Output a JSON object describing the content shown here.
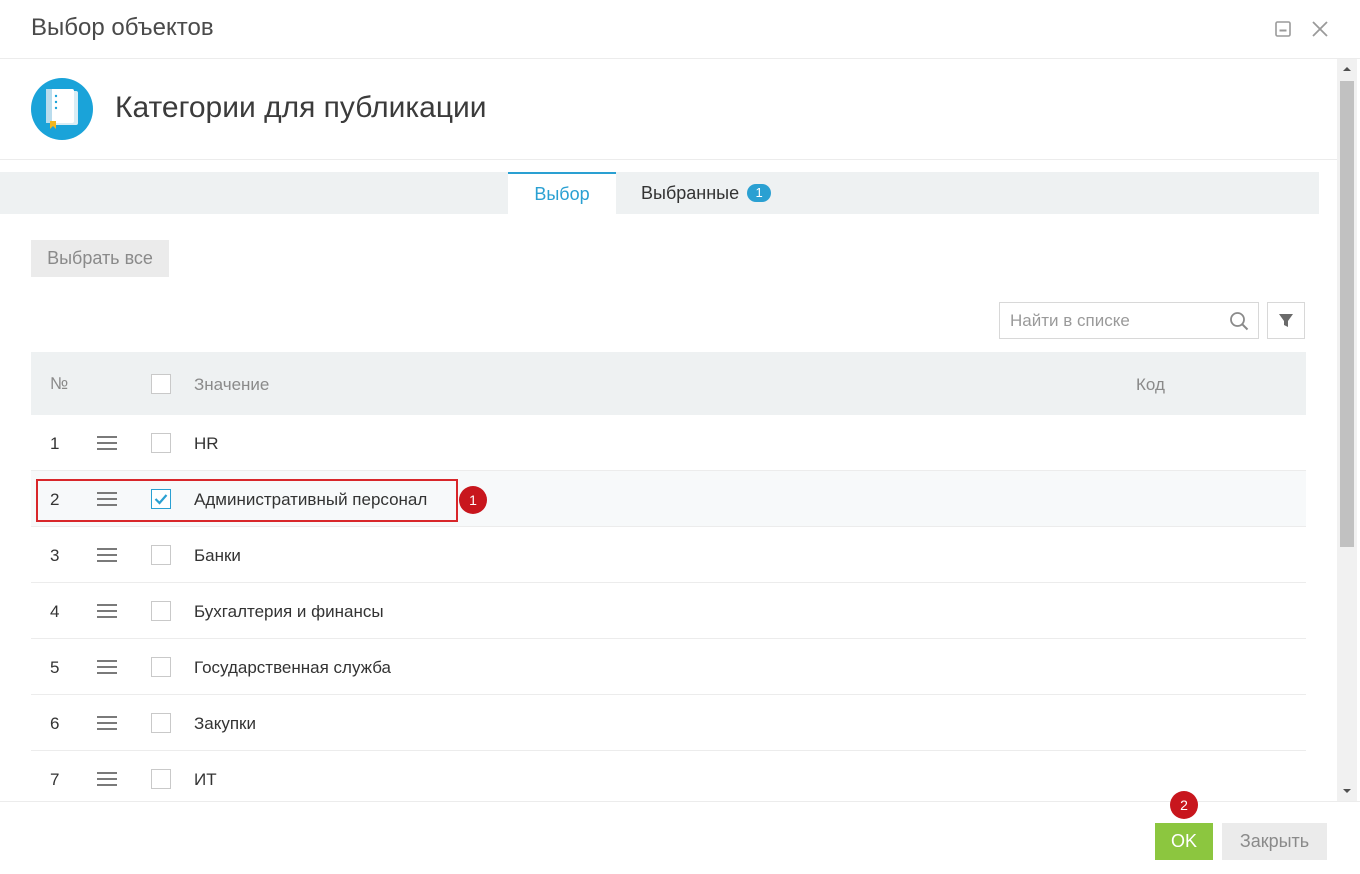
{
  "window": {
    "title": "Выбор объектов",
    "minimize_icon": "minimize-icon",
    "close_icon": "close-icon"
  },
  "object": {
    "title": "Категории для публикации",
    "icon": "book-icon",
    "icon_color": "#1aa3d9"
  },
  "tabs": [
    {
      "label": "Выбор",
      "active": true
    },
    {
      "label": "Выбранные",
      "badge": "1",
      "active": false
    }
  ],
  "toolbar": {
    "select_all_label": "Выбрать все"
  },
  "search": {
    "placeholder": "Найти в списке",
    "icon": "search-icon",
    "filter_icon": "filter-icon"
  },
  "grid": {
    "columns": {
      "num": "№",
      "value": "Значение",
      "code": "Код"
    },
    "rows": [
      {
        "num": "1",
        "label": "HR",
        "checked": false
      },
      {
        "num": "2",
        "label": "Административный персонал",
        "checked": true
      },
      {
        "num": "3",
        "label": "Банки",
        "checked": false
      },
      {
        "num": "4",
        "label": "Бухгалтерия и финансы",
        "checked": false
      },
      {
        "num": "5",
        "label": "Государственная служба",
        "checked": false
      },
      {
        "num": "6",
        "label": "Закупки",
        "checked": false
      },
      {
        "num": "7",
        "label": "ИТ",
        "checked": false
      }
    ]
  },
  "annotations": {
    "marker_1": "1",
    "marker_2": "2",
    "marker_color": "#c8161d"
  },
  "footer": {
    "ok_label": "OK",
    "close_label": "Закрыть"
  },
  "colors": {
    "accent": "#2aa0d2",
    "ok_green": "#8cc63f"
  }
}
